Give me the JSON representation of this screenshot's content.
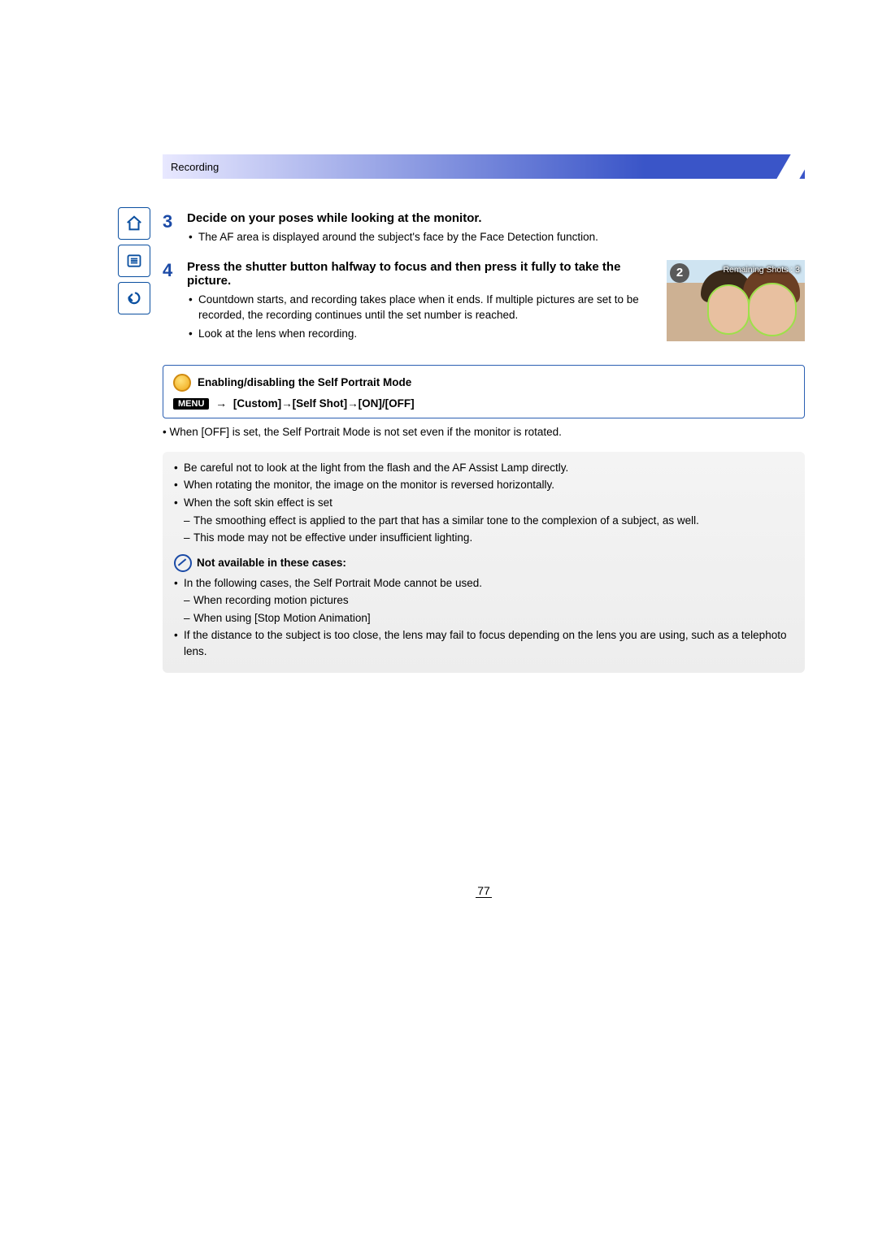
{
  "header": {
    "section": "Recording"
  },
  "sidebar": {
    "home": "home-icon",
    "toc": "toc-icon",
    "back": "back-icon"
  },
  "step3": {
    "num": "3",
    "title": "Decide on your poses while looking at the monitor.",
    "bullet1": "The AF area is displayed around the subject's face by the Face Detection function."
  },
  "step4": {
    "num": "4",
    "title": "Press the shutter button halfway to focus and then press it fully to take the picture.",
    "bullet1": "Countdown starts, and recording takes place when it ends. If multiple pictures are set to be recorded, the recording continues until the set number is reached.",
    "bullet2": "Look at the lens when recording.",
    "badge": "2",
    "remaining": "Remaining Shots : 3"
  },
  "tip": {
    "title": "Enabling/disabling the Self Portrait Mode",
    "menu_label": "MENU",
    "path": "[Custom]→[Self Shot]→[ON]/[OFF]",
    "after": "When [OFF] is set, the Self Portrait Mode is not set even if the monitor is rotated."
  },
  "grey": {
    "b1": "Be careful not to look at the light from the flash and the AF Assist Lamp directly.",
    "b2": "When rotating the monitor, the image on the monitor is reversed horizontally.",
    "b3": "When the soft skin effect is set",
    "b3a": "The smoothing effect is applied to the part that has a similar tone to the complexion of a subject, as well.",
    "b3b": "This mode may not be effective under insufficient lighting.",
    "na_title": "Not available in these cases:",
    "na1": "In the following cases, the Self Portrait Mode cannot be used.",
    "na1a": "When recording motion pictures",
    "na1b": "When using [Stop Motion Animation]",
    "na2": "If the distance to the subject is too close, the lens may fail to focus depending on the lens you are using, such as a telephoto lens."
  },
  "page_number": "77"
}
